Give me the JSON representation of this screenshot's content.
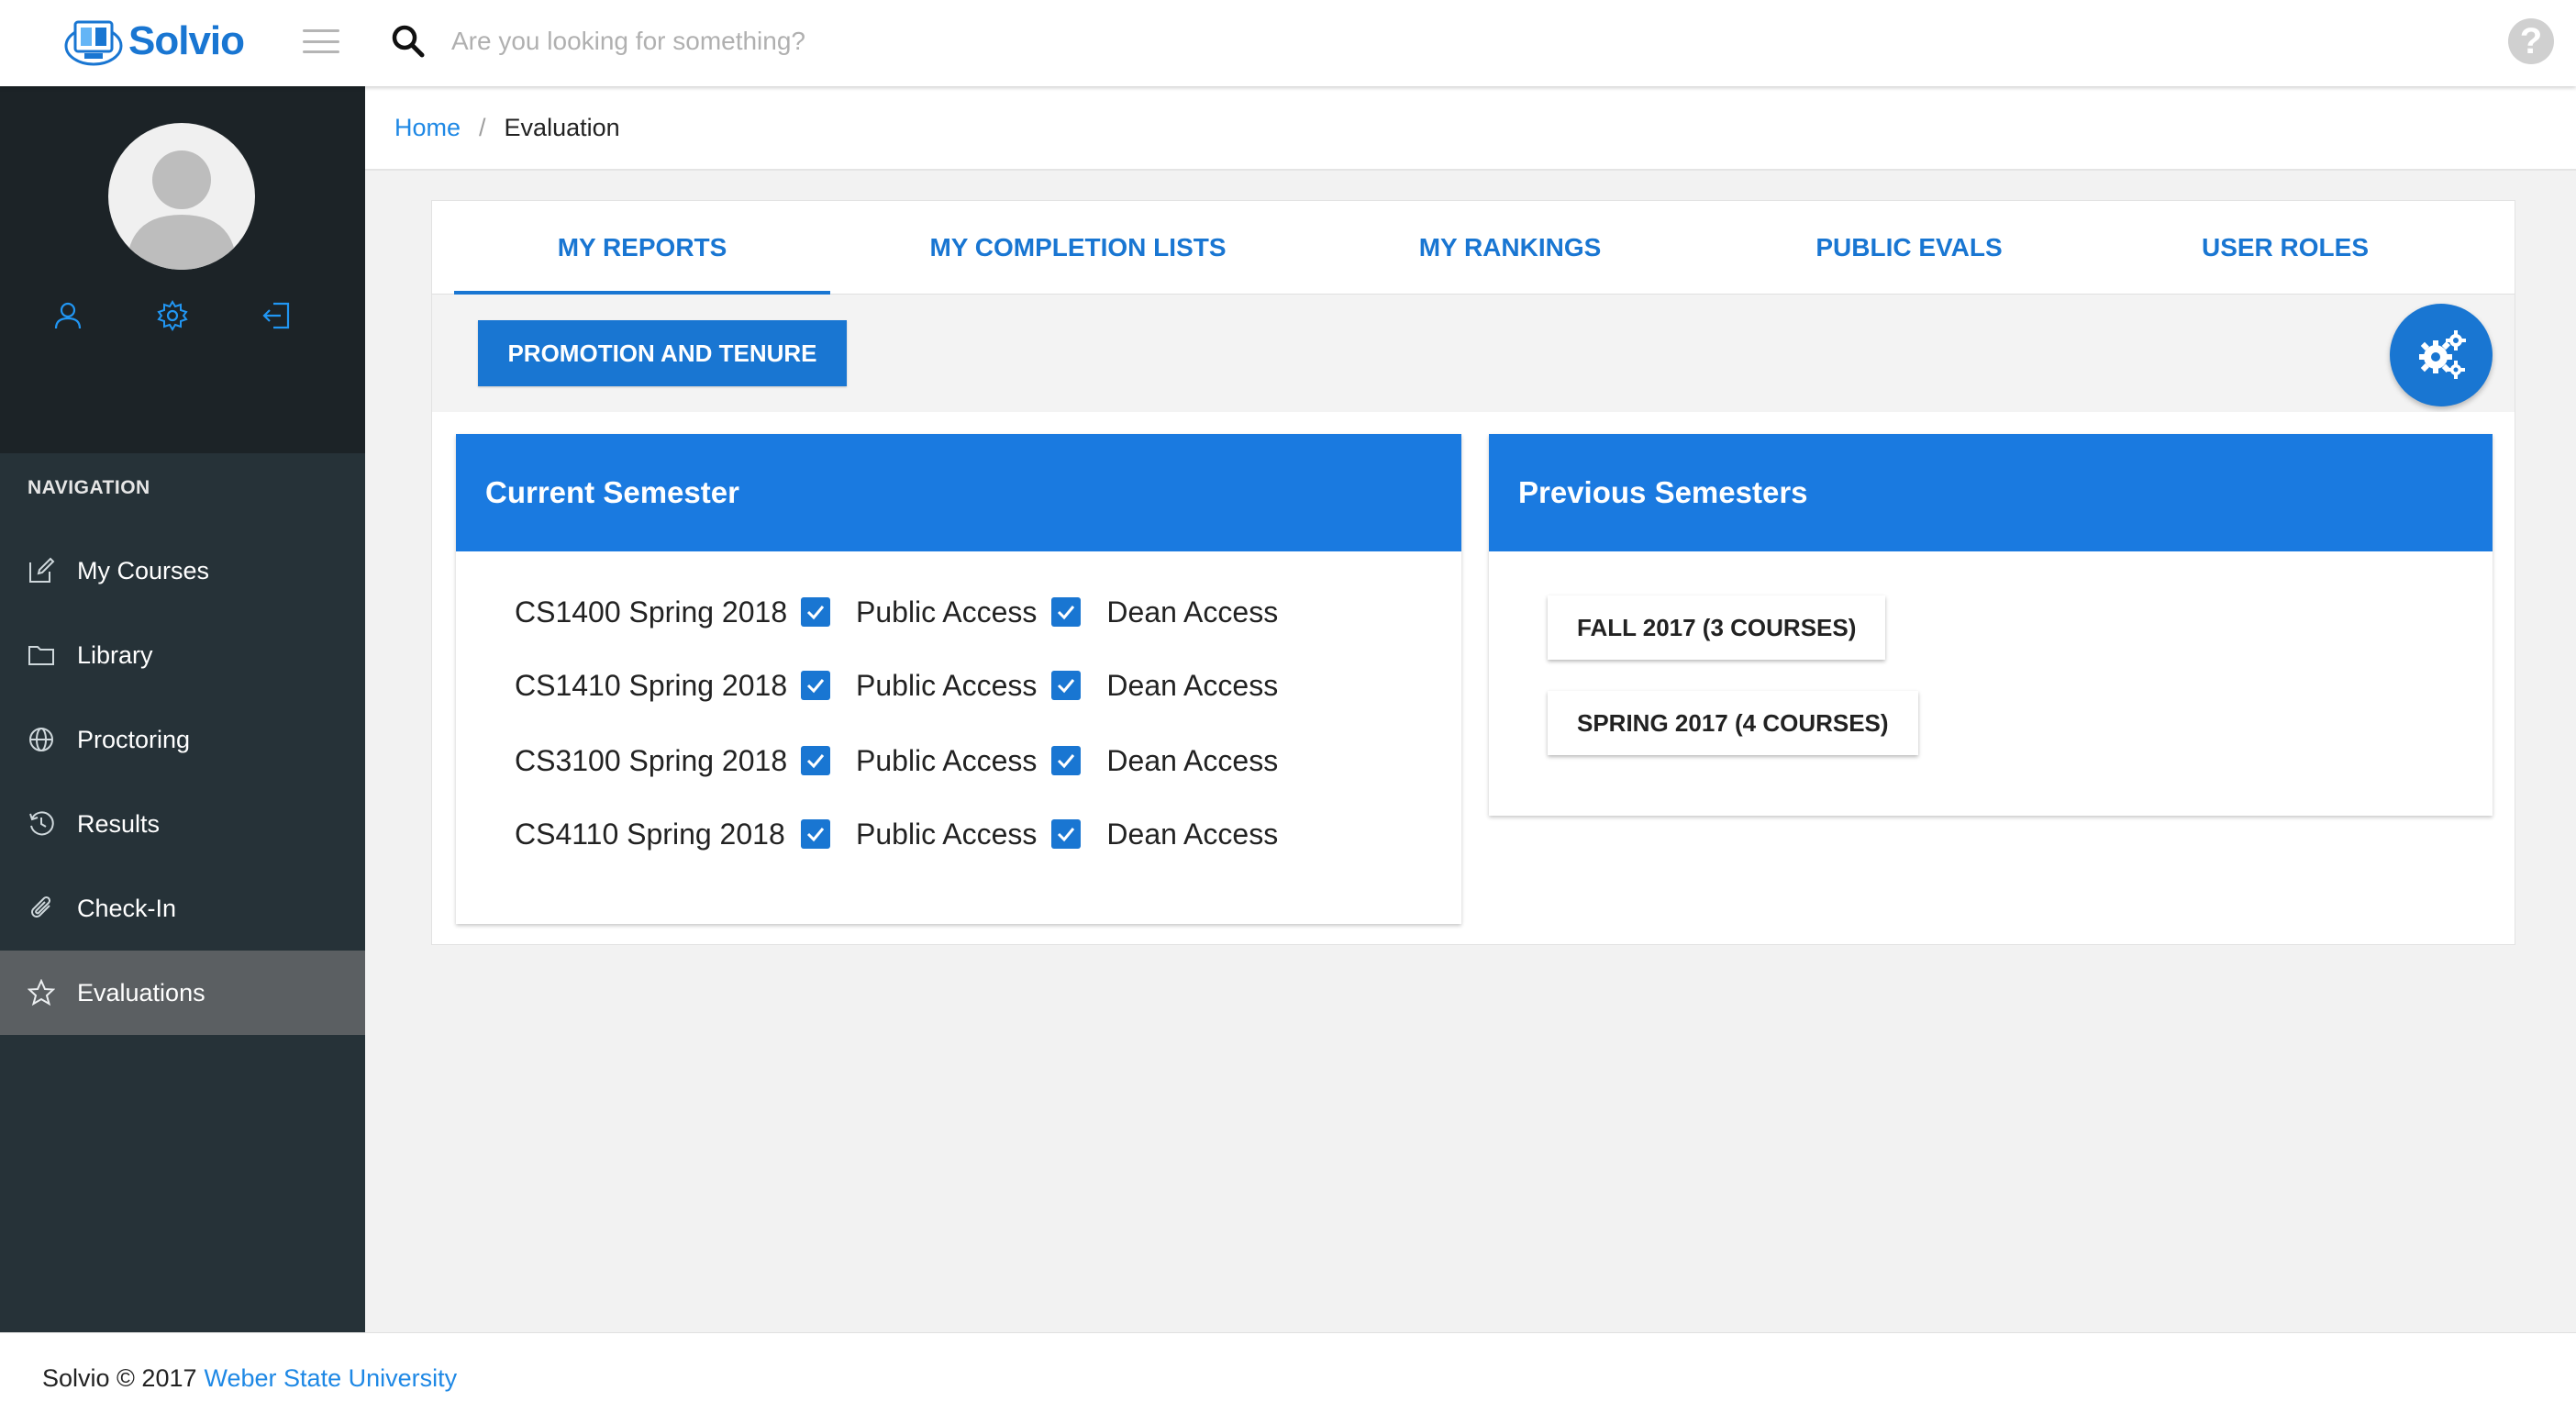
{
  "app": {
    "logo_text": "Solvio",
    "search_placeholder": "Are you looking for something?",
    "help_symbol": "?"
  },
  "colors": {
    "accent": "#1976d2",
    "sidebar_bg": "#263238",
    "sidebar_active": "#5b5f62",
    "card_header": "#1a7ae0"
  },
  "sidebar": {
    "profile_icons": [
      "user-icon",
      "gear-icon",
      "logout-icon"
    ],
    "nav_header": "NAVIGATION",
    "items": [
      {
        "label": "My Courses",
        "icon": "edit-icon"
      },
      {
        "label": "Library",
        "icon": "folder-icon"
      },
      {
        "label": "Proctoring",
        "icon": "globe-icon"
      },
      {
        "label": "Results",
        "icon": "history-icon"
      },
      {
        "label": "Check-In",
        "icon": "paperclip-icon"
      },
      {
        "label": "Evaluations",
        "icon": "star-icon",
        "active": true
      }
    ]
  },
  "breadcrumb": {
    "home": "Home",
    "separator": "/",
    "current": "Evaluation"
  },
  "tabs": [
    {
      "label": "MY REPORTS",
      "active": true
    },
    {
      "label": "MY COMPLETION LISTS"
    },
    {
      "label": "MY RANKINGS"
    },
    {
      "label": "PUBLIC EVALS"
    },
    {
      "label": "USER ROLES"
    }
  ],
  "toolbar": {
    "promotion_button": "PROMOTION AND TENURE",
    "settings_fab_icon": "cogs-icon"
  },
  "current_semester": {
    "title": "Current Semester",
    "courses": [
      {
        "name": "CS1400 Spring 2018",
        "public_label": "Public Access",
        "public_checked": true,
        "dean_label": "Dean Access",
        "dean_checked": true
      },
      {
        "name": "CS1410 Spring 2018",
        "public_label": "Public Access",
        "public_checked": true,
        "dean_label": "Dean Access",
        "dean_checked": true
      },
      {
        "name": "CS3100 Spring 2018",
        "public_label": "Public Access",
        "public_checked": true,
        "dean_label": "Dean Access",
        "dean_checked": true
      },
      {
        "name": "CS4110 Spring 2018",
        "public_label": "Public Access",
        "public_checked": true,
        "dean_label": "Dean Access",
        "dean_checked": true
      }
    ]
  },
  "previous_semesters": {
    "title": "Previous Semesters",
    "buttons": [
      "FALL 2017 (3 COURSES)",
      "SPRING 2017 (4 COURSES)"
    ]
  },
  "footer": {
    "text": "Solvio © 2017",
    "link": "Weber State University"
  }
}
